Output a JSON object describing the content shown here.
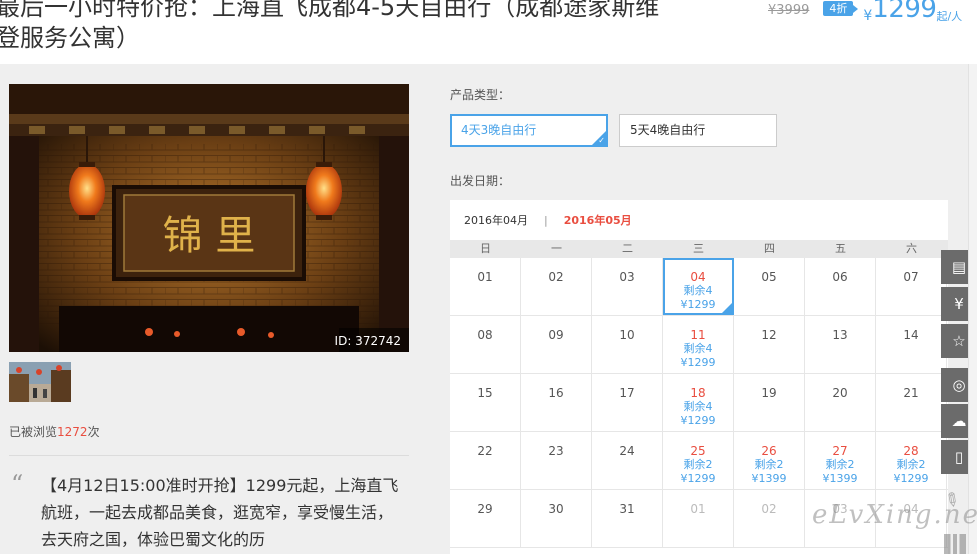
{
  "header": {
    "title_line1": "最后一小时特价抢：上海直飞成都4-5天自由行（成都途家斯维",
    "title_line2": "登服务公寓）",
    "original_price": "¥3999",
    "discount_badge": "4折",
    "currency": "¥",
    "price": "1299",
    "price_unit": "起/人"
  },
  "gallery": {
    "sign_text": "锦  里",
    "photo_id": "ID: 372742"
  },
  "stats": {
    "views_prefix": "已被浏览",
    "views_count": "1272",
    "views_suffix": "次"
  },
  "description": {
    "quote": "“",
    "text": "【4月12日15:00准时开抢】1299元起，上海直飞航班，一起去成都品美食，逛宽窄，享受慢生活，去天府之国，体验巴蜀文化的历"
  },
  "product_type": {
    "label": "产品类型：",
    "options": [
      {
        "label": "4天3晚自由行",
        "selected": true
      },
      {
        "label": "5天4晚自由行",
        "selected": false
      }
    ]
  },
  "departure": {
    "label": "出发日期："
  },
  "calendar": {
    "months": [
      {
        "label": "2016年04月",
        "active": false
      },
      {
        "label": "2016年05月",
        "active": true
      }
    ],
    "separator": "|",
    "weekdays": [
      "日",
      "一",
      "二",
      "三",
      "四",
      "五",
      "六"
    ],
    "weeks": [
      [
        {
          "day": "01"
        },
        {
          "day": "02"
        },
        {
          "day": "03"
        },
        {
          "day": "04",
          "remaining": "剩余4",
          "price": "¥1299",
          "selected": true
        },
        {
          "day": "05"
        },
        {
          "day": "06"
        },
        {
          "day": "07"
        }
      ],
      [
        {
          "day": "08"
        },
        {
          "day": "09"
        },
        {
          "day": "10"
        },
        {
          "day": "11",
          "remaining": "剩余4",
          "price": "¥1299"
        },
        {
          "day": "12"
        },
        {
          "day": "13"
        },
        {
          "day": "14"
        }
      ],
      [
        {
          "day": "15"
        },
        {
          "day": "16"
        },
        {
          "day": "17"
        },
        {
          "day": "18",
          "remaining": "剩余4",
          "price": "¥1299"
        },
        {
          "day": "19"
        },
        {
          "day": "20"
        },
        {
          "day": "21"
        }
      ],
      [
        {
          "day": "22"
        },
        {
          "day": "23"
        },
        {
          "day": "24"
        },
        {
          "day": "25",
          "remaining": "剩余2",
          "price": "¥1299"
        },
        {
          "day": "26",
          "remaining": "剩余2",
          "price": "¥1399"
        },
        {
          "day": "27",
          "remaining": "剩余2",
          "price": "¥1399"
        },
        {
          "day": "28",
          "remaining": "剩余2",
          "price": "¥1299"
        }
      ],
      [
        {
          "day": "29"
        },
        {
          "day": "30"
        },
        {
          "day": "31"
        },
        {
          "day": "01",
          "faded": true
        },
        {
          "day": "02",
          "faded": true
        },
        {
          "day": "03",
          "faded": true
        },
        {
          "day": "04",
          "faded": true
        }
      ]
    ]
  },
  "toolbar": {
    "items": [
      {
        "name": "notes-icon",
        "glyph": "▤"
      },
      {
        "name": "yen-icon",
        "glyph": "¥"
      },
      {
        "name": "star-icon",
        "glyph": "☆"
      },
      {
        "name": "weibo-icon",
        "glyph": "◎"
      },
      {
        "name": "wechat-icon",
        "glyph": "☁"
      },
      {
        "name": "phone-icon",
        "glyph": "▯"
      }
    ]
  },
  "watermark": "eLvXing.net",
  "colors": {
    "accent_blue": "#4aa3e8",
    "accent_red": "#e94e40",
    "panel_gray": "#efefef",
    "toolbar_gray": "#6b6b6b"
  }
}
